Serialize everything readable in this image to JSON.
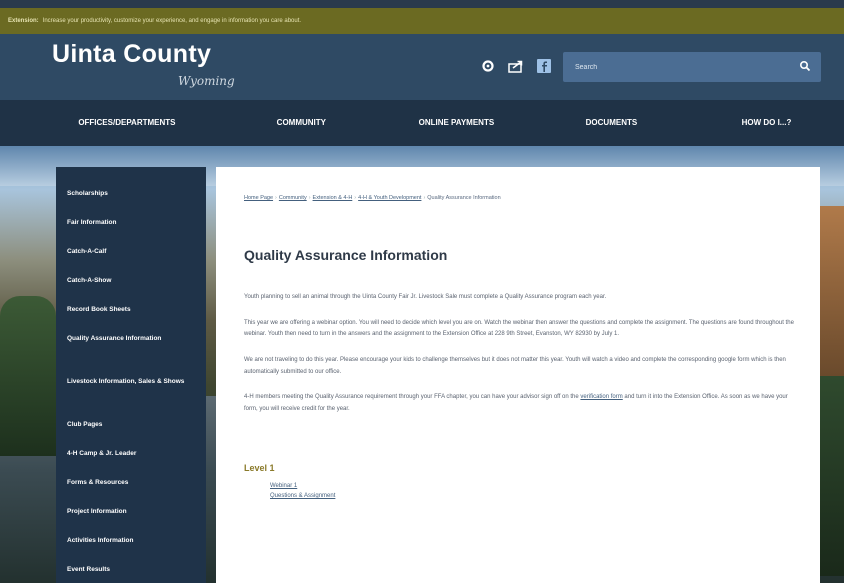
{
  "alert": {
    "label": "Extension:",
    "text": "Increase your productivity, customize your experience, and engage in information you care about."
  },
  "header": {
    "title": "Uinta County",
    "subtitle": "Wyoming",
    "search_placeholder": "Search"
  },
  "icons": {
    "gear": "gear-icon",
    "share": "share-icon",
    "facebook": "facebook-icon",
    "search": "search-icon"
  },
  "nav": {
    "items": [
      "OFFICES/DEPARTMENTS",
      "COMMUNITY",
      "ONLINE PAYMENTS",
      "DOCUMENTS",
      "HOW DO I...?"
    ]
  },
  "sidebar": {
    "items": [
      "Scholarships",
      "Fair Information",
      "Catch-A-Calf",
      "Catch-A-Show",
      "Record Book Sheets",
      "Quality Assurance Information",
      "Livestock Information, Sales & Shows",
      "Club Pages",
      "4-H Camp & Jr. Leader",
      "Forms & Resources",
      "Project Information",
      "Activities Information",
      "Event Results"
    ]
  },
  "content": {
    "breadcrumb": [
      "Home Page",
      "Community",
      "Extension & 4-H",
      "4-H & Youth Development",
      "Quality Assurance Information"
    ],
    "title": "Quality Assurance Information",
    "paragraphs": [
      "Youth planning to sell an animal through the Uinta County Fair Jr. Livestock Sale must complete a Quality Assurance program each year.",
      "This year we are offering a webinar option. You will need to decide which level you are on. Watch the webinar then answer the questions and complete the assignment. The questions are found throughout the webinar. Youth then need to turn in the answers and the assignment to the Extension Office at 228 9th Street, Evanston, WY 82930 by July 1.",
      "We are not traveling to do this year. Please encourage your kids to challenge themselves but it does not matter this year. Youth will watch a video and complete the corresponding google form which is then automatically submitted to our office."
    ],
    "paragraph4_before": "4-H members meeting the Quality Assurance requirement through your FFA chapter, you can have your advisor sign off on the ",
    "paragraph4_link": "verification form",
    "paragraph4_after": " and turn it into the Extension Office. As soon as we have your form, you will receive credit for the year.",
    "level_title": "Level 1",
    "level_links": [
      "Webinar 1",
      "Questions & Assignment"
    ]
  }
}
